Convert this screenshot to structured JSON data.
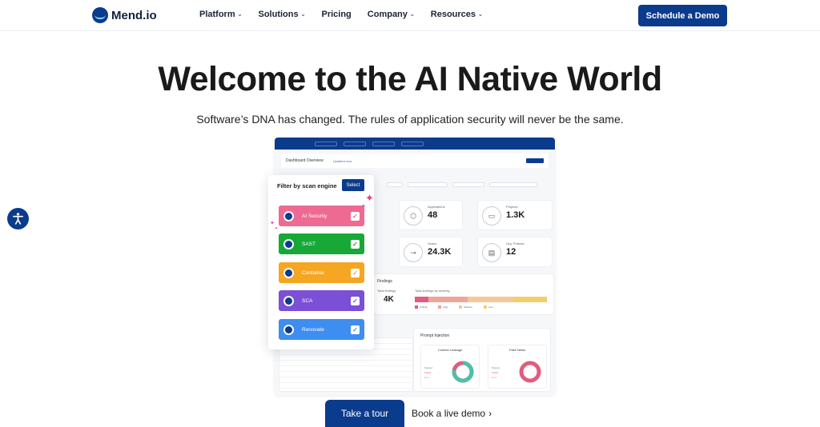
{
  "nav": {
    "brand": "Mend.io",
    "items": [
      {
        "label": "Platform",
        "has_dropdown": true
      },
      {
        "label": "Solutions",
        "has_dropdown": true
      },
      {
        "label": "Pricing",
        "has_dropdown": false
      },
      {
        "label": "Company",
        "has_dropdown": true
      },
      {
        "label": "Resources",
        "has_dropdown": true
      }
    ],
    "cta": "Schedule a Demo"
  },
  "hero": {
    "title_regular": "Welcome to the ",
    "title_bold": "AI Native World",
    "subtitle": "Software’s DNA has changed. The rules of application security will never be the same."
  },
  "dashboard": {
    "header_title": "Dashboard Overview",
    "updated": "Updated now",
    "stats": [
      {
        "label": "Applications",
        "value": "48",
        "icon": "cube-icon"
      },
      {
        "label": "Projects",
        "value": "1.3K",
        "icon": "folder-icon"
      },
      {
        "label": "Scans",
        "value": "24.3K",
        "icon": "commit-icon"
      },
      {
        "label": "Org. Policies",
        "value": "12",
        "icon": "clipboard-icon"
      }
    ],
    "findings": {
      "title": "Findings",
      "total_label": "Total findings",
      "total_value": "4K",
      "severity_label": "Total findings by severity",
      "severity": [
        {
          "name": "Critical",
          "value": 0.1,
          "color": "#e25c7f"
        },
        {
          "name": "High",
          "value": 0.3,
          "color": "#f0a49a"
        },
        {
          "name": "Medium",
          "value": 0.35,
          "color": "#f7c79a"
        },
        {
          "name": "Low",
          "value": 0.25,
          "color": "#f4cd6b"
        }
      ]
    },
    "prompt_injection": {
      "title": "Prompt Injection",
      "cards": [
        {
          "title": "Context Leakage",
          "legend": [
            "Passed",
            "Failed",
            "Error"
          ],
          "passed_fraction": 0.78,
          "colors": [
            "#4cc0a8",
            "#e25c7f"
          ]
        },
        {
          "title": "Fake News",
          "legend": [
            "Passed",
            "Failed",
            "Error"
          ],
          "passed_fraction": 0.0,
          "colors": [
            "#4cc0a8",
            "#e25c7f"
          ]
        }
      ]
    }
  },
  "filter_panel": {
    "title": "Filter by scan engine",
    "select_label": "Select",
    "engines": [
      {
        "label": "AI Security",
        "color": "#ee6a92",
        "checked": true
      },
      {
        "label": "SAST",
        "color": "#17a838",
        "checked": true
      },
      {
        "label": "Container",
        "color": "#f5a623",
        "checked": true
      },
      {
        "label": "SCA",
        "color": "#7b4fd6",
        "checked": true
      },
      {
        "label": "Renovate",
        "color": "#3e8df0",
        "checked": true
      }
    ]
  },
  "ctas": {
    "tour": "Take a tour",
    "live_demo": "Book a live demo",
    "live_demo_arrow": "›"
  },
  "colors": {
    "brand": "#0b3b8c"
  }
}
